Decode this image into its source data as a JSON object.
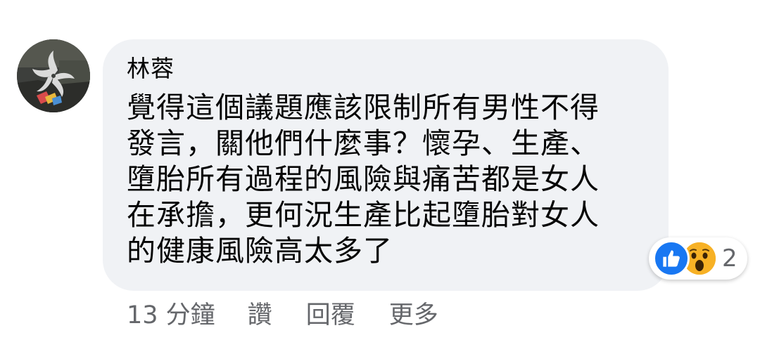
{
  "comment": {
    "author": "林蓉",
    "text": "覺得這個議題應該限制所有男性不得發言，關他們什麼事？懷孕、生產、墮胎所有過程的風險與痛苦都是女人在承擔，更何況生產比起墮胎對女人的健康風險高太多了",
    "avatar": "profile-photo",
    "reactions": {
      "icons": [
        "like-icon",
        "wow-icon"
      ],
      "count": "2"
    },
    "timestamp": "13 分鐘",
    "actions": {
      "like": "讚",
      "reply": "回覆",
      "more": "更多"
    }
  },
  "colors": {
    "bubble": "#f0f2f5",
    "text": "#050505",
    "meta": "#65676b",
    "like": "#1877f2",
    "wow": "#f7b125"
  }
}
